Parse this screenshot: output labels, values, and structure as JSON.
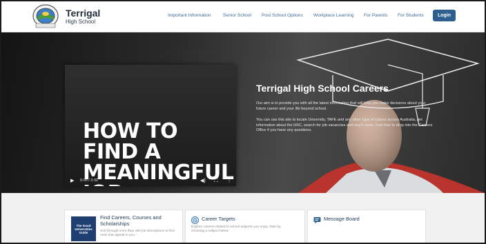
{
  "header": {
    "school_name": "Terrigal",
    "school_sub": "High School",
    "logo_icon": "school-crest-icon",
    "nav": [
      {
        "label": "Important Information"
      },
      {
        "label": "Senior School"
      },
      {
        "label": "Post School Options"
      },
      {
        "label": "Workplace Learning"
      },
      {
        "label": "For Parents"
      },
      {
        "label": "For Students"
      }
    ],
    "login_label": "Login"
  },
  "video": {
    "title": "HOW TO FIND A MEANINGFUL JOB",
    "time": "0:00 / 3:32",
    "play_icon": "play-icon",
    "volume_icon": "volume-icon",
    "fullscreen_icon": "fullscreen-icon",
    "more_icon": "more-options-icon"
  },
  "hero": {
    "heading": "Terrigal High School Careers",
    "paragraph_1": "Our aim is to provide you with all the latest information that will help you make decisions about your future career and your life beyond school.",
    "paragraph_2": "You can use this site to locate University, TAFE and any other type of course across Australia, get information about the HSC, search for job vacancies and much more. Feel free to drop into the Careers Office if you have any questions."
  },
  "cards": [
    {
      "title": "Find Careers, Courses and Scholarships",
      "description": "Sort through more than 450 job descriptions to find ones that appeal to you.",
      "image_text": "The Good Universities Guide"
    },
    {
      "title": "Career Targets",
      "description": "Explore careers related to school subjects you enjoy. Start by choosing a subject below.",
      "icon": "target-icon"
    },
    {
      "title": "Message Board",
      "icon": "message-board-icon"
    }
  ],
  "colors": {
    "nav_link": "#3c6b98",
    "login_button": "#2e5f8e",
    "card_title": "#24415e"
  }
}
